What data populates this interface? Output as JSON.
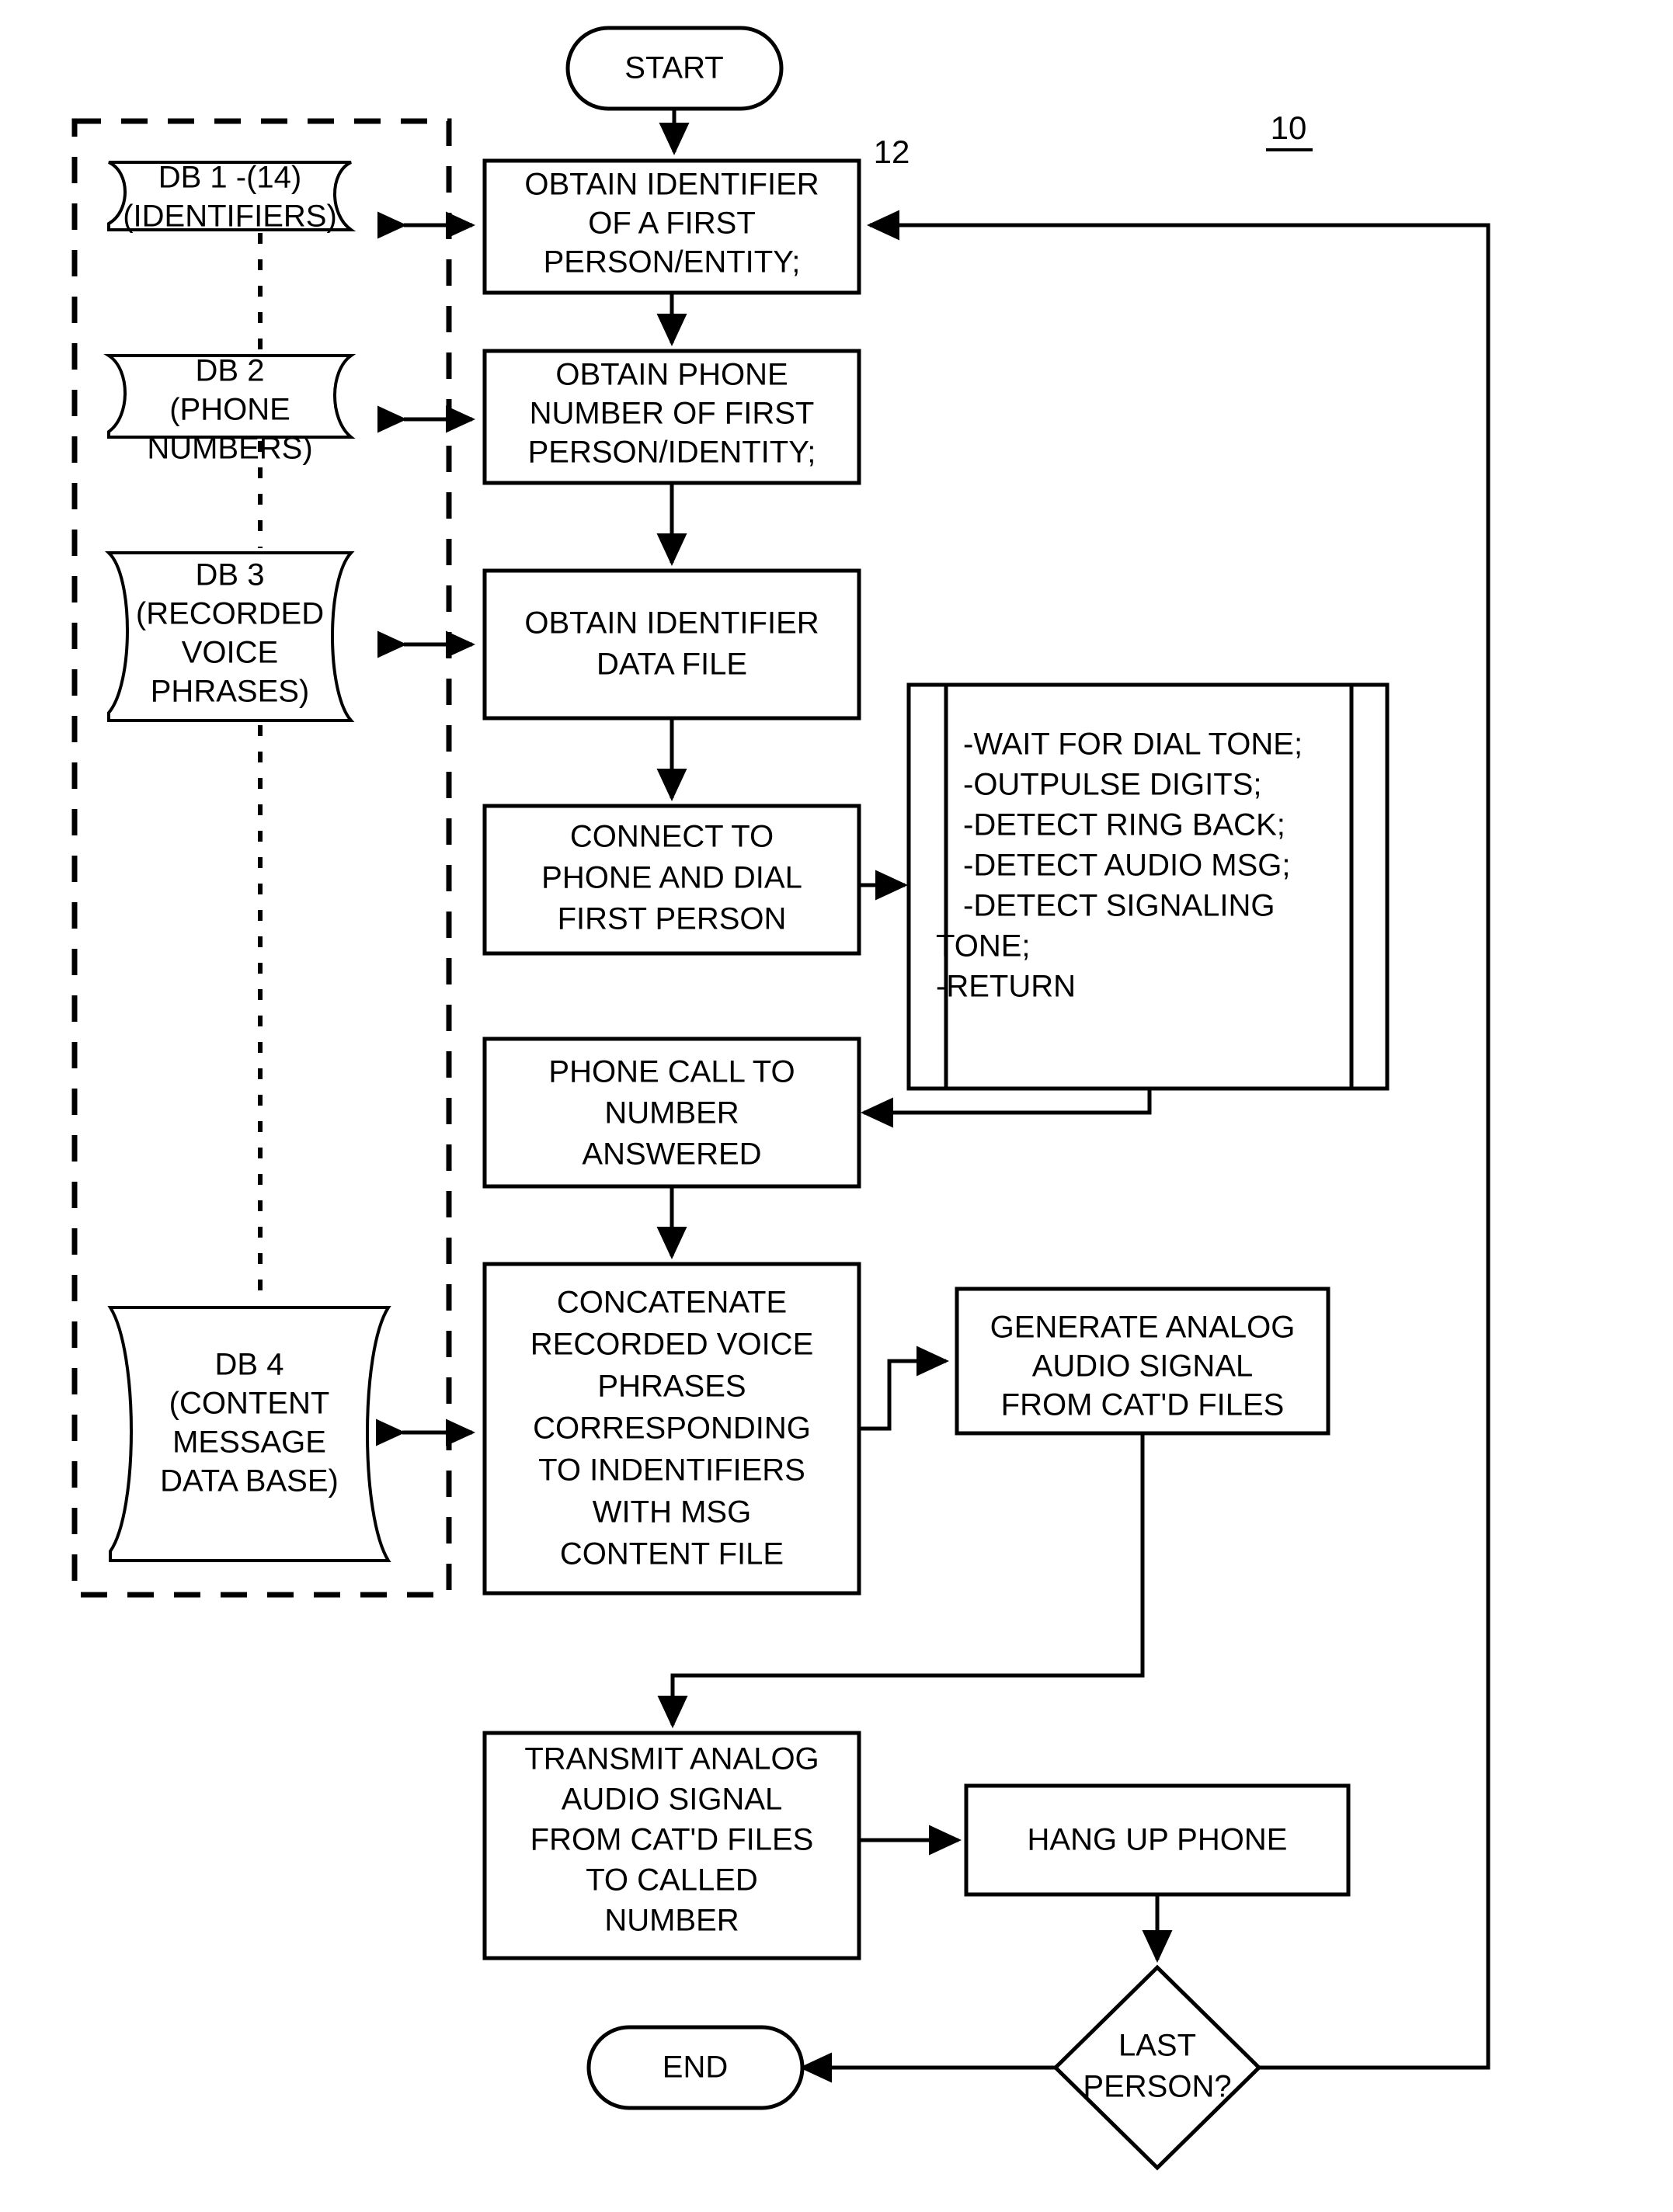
{
  "figure": {
    "reference_numeral_main": "10",
    "reference_numeral_process": "12"
  },
  "terminators": {
    "start": "START",
    "end": "END"
  },
  "decision": {
    "last_person": [
      "LAST",
      "PERSON?"
    ]
  },
  "databases": [
    {
      "id": "db1",
      "lines": [
        "DB 1 -(14)",
        "(IDENTIFIERS)"
      ]
    },
    {
      "id": "db2",
      "lines": [
        "DB 2",
        "(PHONE",
        "NUMBERS)"
      ]
    },
    {
      "id": "db3",
      "lines": [
        "DB 3",
        "(RECORDED",
        "VOICE",
        "PHRASES)"
      ]
    },
    {
      "id": "db4",
      "lines": [
        "DB 4",
        "(CONTENT",
        "MESSAGE",
        "DATA BASE)"
      ]
    }
  ],
  "process_steps": [
    {
      "id": "obtain-identifier-person",
      "lines": [
        "OBTAIN IDENTIFIER",
        "OF A FIRST",
        "PERSON/ENTITY;"
      ]
    },
    {
      "id": "obtain-phone-number",
      "lines": [
        "OBTAIN PHONE",
        "NUMBER OF FIRST",
        "PERSON/IDENTITY;"
      ]
    },
    {
      "id": "obtain-identifier-data-file",
      "lines": [
        "OBTAIN IDENTIFIER",
        "DATA FILE"
      ]
    },
    {
      "id": "connect-and-dial",
      "lines": [
        "CONNECT TO",
        "PHONE AND DIAL",
        "FIRST PERSON"
      ]
    },
    {
      "id": "call-answered",
      "lines": [
        "PHONE CALL TO",
        "NUMBER",
        "ANSWERED"
      ]
    },
    {
      "id": "concatenate-phrases",
      "lines": [
        "CONCATENATE",
        "RECORDED VOICE",
        "PHRASES",
        "CORRESPONDING",
        "TO INDENTIFIERS",
        "WITH MSG",
        "CONTENT FILE"
      ]
    },
    {
      "id": "generate-analog-audio",
      "lines": [
        "GENERATE ANALOG",
        "AUDIO SIGNAL",
        "FROM CAT'D FILES"
      ]
    },
    {
      "id": "transmit-analog-audio",
      "lines": [
        "TRANSMIT ANALOG",
        "AUDIO SIGNAL",
        "FROM CAT'D FILES",
        "TO CALLED",
        "NUMBER"
      ]
    },
    {
      "id": "hang-up-phone",
      "lines": [
        "HANG UP PHONE"
      ]
    }
  ],
  "subroutine": {
    "id": "dial-sequence",
    "lines": [
      "-WAIT FOR DIAL TONE;",
      "-OUTPULSE DIGITS;",
      "-DETECT RING BACK;",
      "-DETECT AUDIO MSG;",
      "-DETECT SIGNALING",
      "TONE;",
      "-RETURN"
    ]
  },
  "colors": {
    "ink": "#000000",
    "paper": "#ffffff"
  }
}
